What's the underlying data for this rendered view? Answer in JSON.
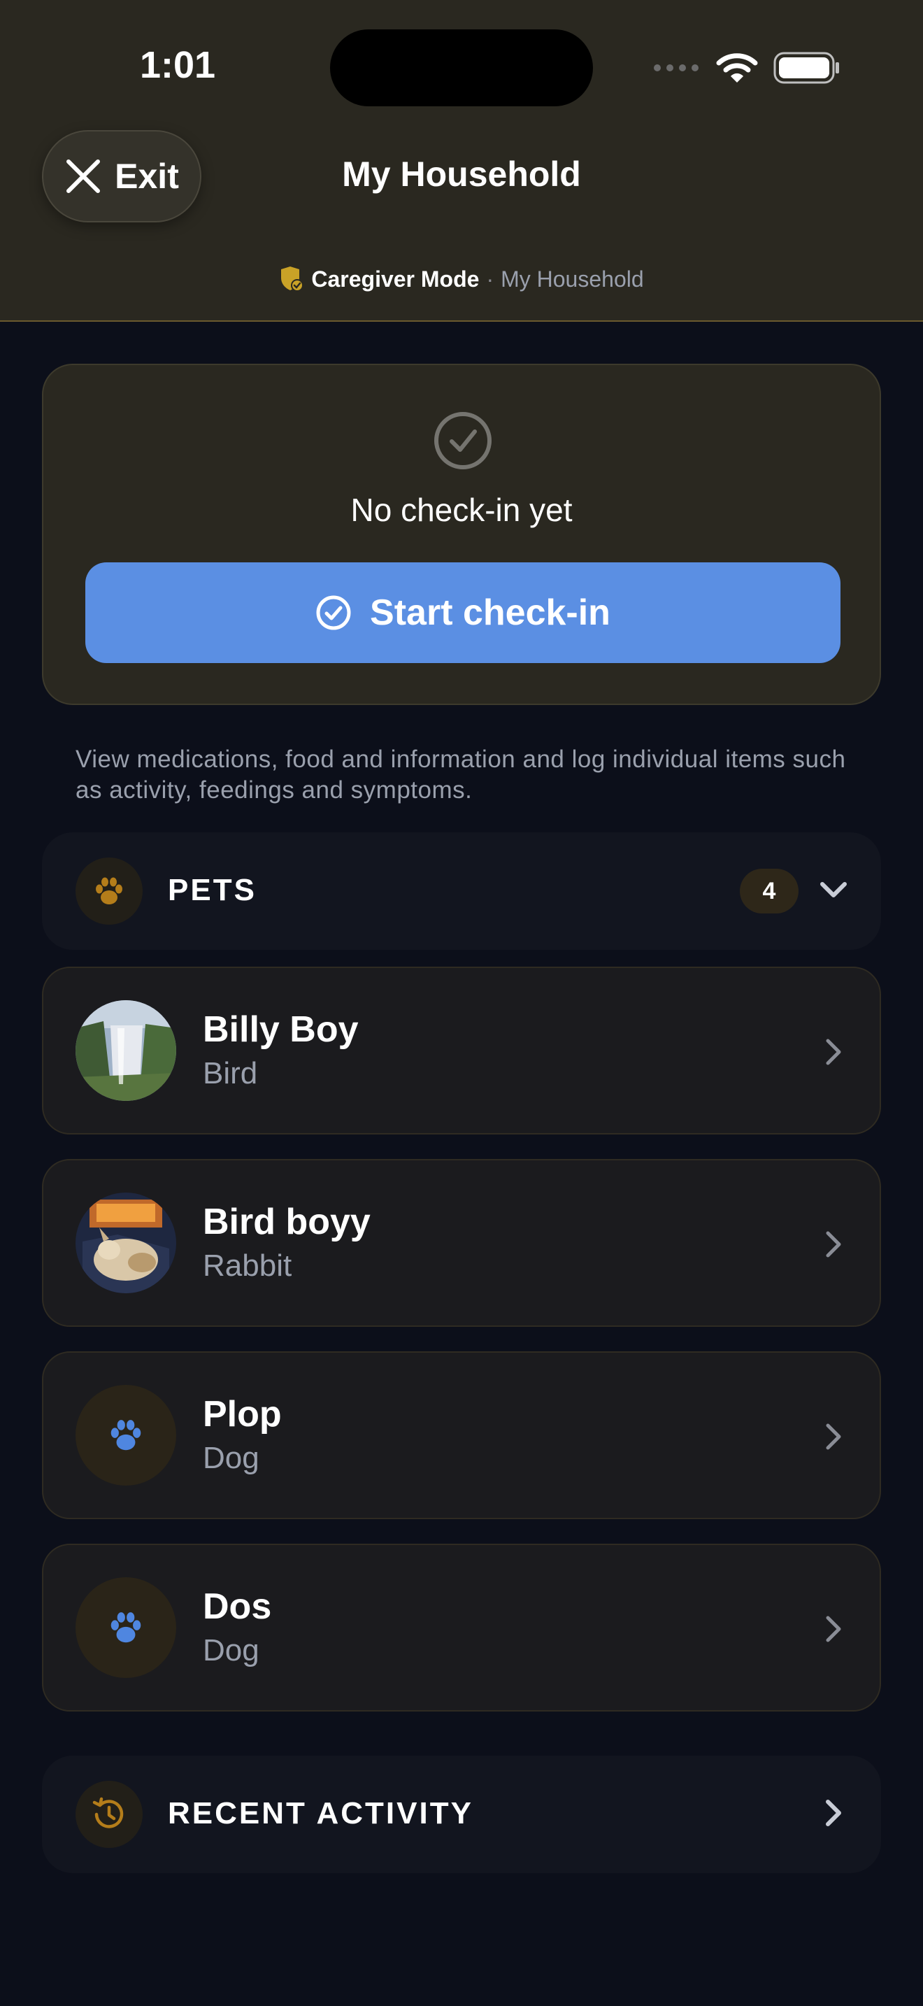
{
  "status_bar": {
    "time": "1:01"
  },
  "header": {
    "exit_label": "Exit",
    "title": "My Household",
    "mode_label": "Caregiver Mode",
    "mode_separator": "·",
    "mode_household": "My Household"
  },
  "checkin": {
    "status_text": "No check-in yet",
    "button_label": "Start check-in"
  },
  "info_text": "View medications, food and information and log individual items such as activity, feedings and symptoms.",
  "pets_section": {
    "label": "PETS",
    "count": "4"
  },
  "pets": [
    {
      "name": "Billy Boy",
      "type": "Bird",
      "avatar": "photo-waterfall"
    },
    {
      "name": "Bird boyy",
      "type": "Rabbit",
      "avatar": "photo-pet"
    },
    {
      "name": "Plop",
      "type": "Dog",
      "avatar": "paw-icon"
    },
    {
      "name": "Dos",
      "type": "Dog",
      "avatar": "paw-icon"
    }
  ],
  "recent_activity": {
    "label": "RECENT ACTIVITY"
  },
  "colors": {
    "header_bg": "#2a2820",
    "page_bg": "#0c0f1a",
    "accent_blue": "#5b8fe3",
    "accent_gold": "#c9a227",
    "paw_blue": "#4f86e0"
  }
}
